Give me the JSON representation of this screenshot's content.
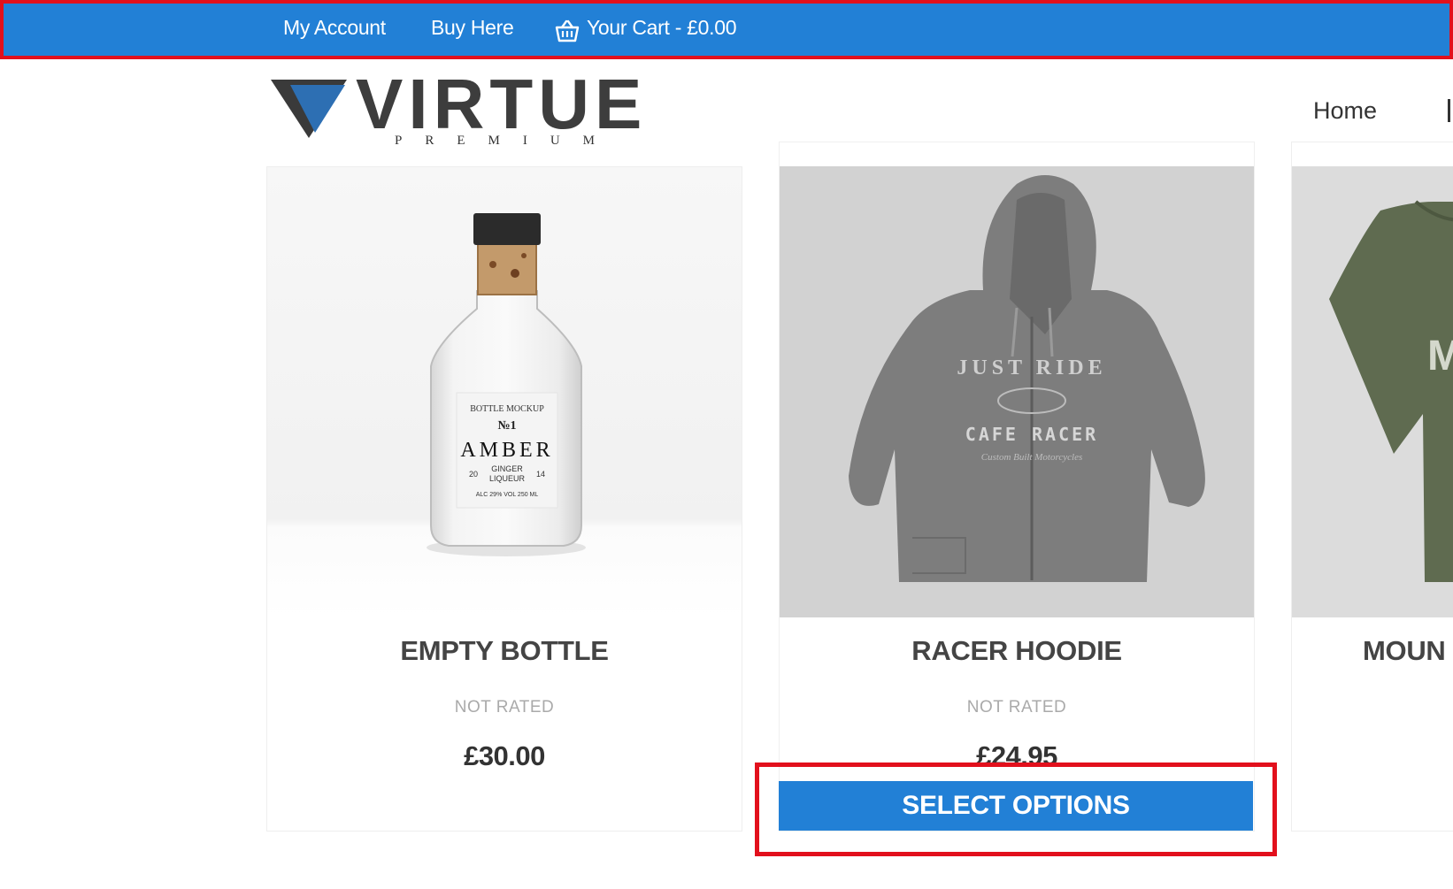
{
  "topbar": {
    "my_account": "My Account",
    "buy_here": "Buy Here",
    "cart": "Your Cart - £0.00",
    "background": "#2280d6"
  },
  "header": {
    "logo_word": "VIRTUE",
    "logo_sub": "PREMIUM",
    "nav": {
      "home": "Home"
    }
  },
  "products": [
    {
      "title": "EMPTY BOTTLE",
      "rating": "NOT RATED",
      "price": "£30.00",
      "label": {
        "top": "BOTTLE MOCKUP",
        "number": "№1",
        "name": "AMBER",
        "sub1": "GINGER",
        "sub2": "LIQUEUR",
        "year_left": "20",
        "year_right": "14",
        "foot": "ALC 29% VOL 250 ML"
      }
    },
    {
      "title": "RACER HOODIE",
      "rating": "NOT RATED",
      "price": "£24.95",
      "button": "SELECT OPTIONS",
      "print": {
        "line1": "JUST RIDE",
        "line2": "CAFE RACER",
        "line3": "Custom Built Motorcycles"
      }
    },
    {
      "title": "MOUN",
      "print": "M"
    }
  ],
  "accent": "#2280d6",
  "highlight": "#e2101c"
}
